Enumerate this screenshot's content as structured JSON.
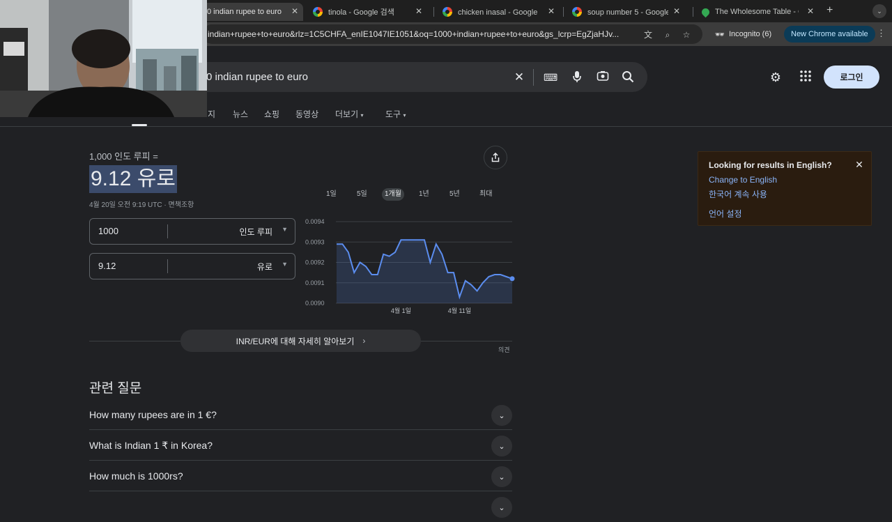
{
  "tabs": [
    {
      "label": "0 indian rupee to euro",
      "icon": "google-icon",
      "active": true
    },
    {
      "label": "tinola - Google 검색",
      "icon": "google-icon"
    },
    {
      "label": "chicken inasal - Google 검",
      "icon": "google-icon"
    },
    {
      "label": "soup number 5 - Google 검",
      "icon": "google-icon"
    },
    {
      "label": "The Wholesome Table - G",
      "icon": "maps-pin-icon"
    }
  ],
  "toolbar": {
    "url": "indian+rupee+to+euro&rlz=1C5CHFA_enIE1047IE1051&oq=1000+indian+rupee+to+euro&gs_lcrp=EgZjaHJv...",
    "incognito_label": "Incognito (6)",
    "update_label": "New Chrome available"
  },
  "search": {
    "query": "0 indian rupee to euro"
  },
  "header": {
    "login_label": "로그인"
  },
  "nav": {
    "items": [
      "지",
      "뉴스",
      "쇼핑",
      "동영상",
      "더보기",
      "도구"
    ]
  },
  "converter": {
    "heading": "1,000 인도 루피 =",
    "result": "9.12 유로",
    "date": "4월 20일 오전 9:19 UTC · 면책조항",
    "from_value": "1000",
    "from_unit": "인도 루피",
    "to_value": "9.12",
    "to_unit": "유로",
    "ranges": [
      "1일",
      "5일",
      "1개월",
      "1년",
      "5년",
      "최대"
    ],
    "selected_range": "1개월",
    "learn_more": "INR/EUR에 대해 자세히 알아보기",
    "feedback": "의견"
  },
  "chart_data": {
    "type": "line",
    "x": [
      "3/21",
      "3/22",
      "3/23",
      "3/24",
      "3/25",
      "3/26",
      "3/27",
      "3/28",
      "3/29",
      "3/30",
      "3/31",
      "4/1",
      "4/2",
      "4/3",
      "4/4",
      "4/5",
      "4/6",
      "4/7",
      "4/8",
      "4/9",
      "4/10",
      "4/11",
      "4/12",
      "4/13",
      "4/14",
      "4/15",
      "4/16",
      "4/17",
      "4/18",
      "4/19",
      "4/20"
    ],
    "values": [
      0.00929,
      0.00929,
      0.00925,
      0.00915,
      0.0092,
      0.00918,
      0.00914,
      0.00914,
      0.00924,
      0.00923,
      0.00925,
      0.00931,
      0.00931,
      0.00931,
      0.00931,
      0.00931,
      0.0092,
      0.00929,
      0.00924,
      0.00915,
      0.00915,
      0.00903,
      0.00911,
      0.00909,
      0.00906,
      0.0091,
      0.00913,
      0.00914,
      0.00914,
      0.00913,
      0.00912
    ],
    "ylim": [
      0.009,
      0.0094
    ],
    "yticks": [
      "0.0094",
      "0.0093",
      "0.0092",
      "0.0091",
      "0.0090"
    ],
    "xticks": [
      "4월 1일",
      "4월 11일"
    ],
    "grid": true,
    "color": "#5b8def"
  },
  "faq": {
    "title": "관련 질문",
    "questions": [
      "How many rupees are in 1 €?",
      "What is Indian 1 ₹ in Korea?",
      "How much is 1000rs?"
    ]
  },
  "lang_popup": {
    "title": "Looking for results in English?",
    "change_link": "Change to English",
    "keep_link": "한국어 계속 사용",
    "settings_link": "언어 설정"
  }
}
